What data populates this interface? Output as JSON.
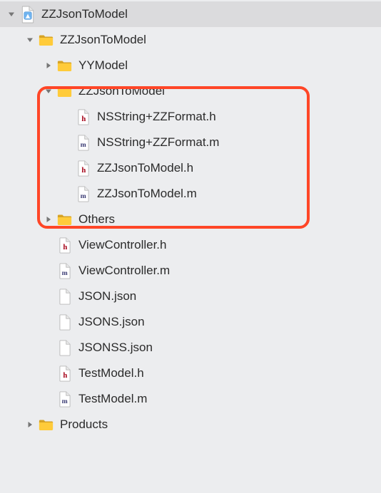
{
  "tree": {
    "root": {
      "label": "ZZJsonToModel",
      "expanded": true,
      "children": {
        "group1": {
          "label": "ZZJsonToModel",
          "expanded": true,
          "children": {
            "yymodel": {
              "label": "YYModel",
              "expanded": false
            },
            "zzjson": {
              "label": "ZZJsonToModel",
              "expanded": true,
              "children": {
                "f0": {
                  "label": "NSString+ZZFormat.h",
                  "kind": "h"
                },
                "f1": {
                  "label": "NSString+ZZFormat.m",
                  "kind": "m"
                },
                "f2": {
                  "label": "ZZJsonToModel.h",
                  "kind": "h"
                },
                "f3": {
                  "label": "ZZJsonToModel.m",
                  "kind": "m"
                }
              }
            },
            "others": {
              "label": "Others",
              "expanded": false
            },
            "vc_h": {
              "label": "ViewController.h",
              "kind": "h"
            },
            "vc_m": {
              "label": "ViewController.m",
              "kind": "m"
            },
            "j1": {
              "label": "JSON.json",
              "kind": "file"
            },
            "j2": {
              "label": "JSONS.json",
              "kind": "file"
            },
            "j3": {
              "label": "JSONSS.json",
              "kind": "file"
            },
            "tm_h": {
              "label": "TestModel.h",
              "kind": "h"
            },
            "tm_m": {
              "label": "TestModel.m",
              "kind": "m"
            }
          }
        },
        "products": {
          "label": "Products",
          "expanded": false
        }
      }
    }
  }
}
